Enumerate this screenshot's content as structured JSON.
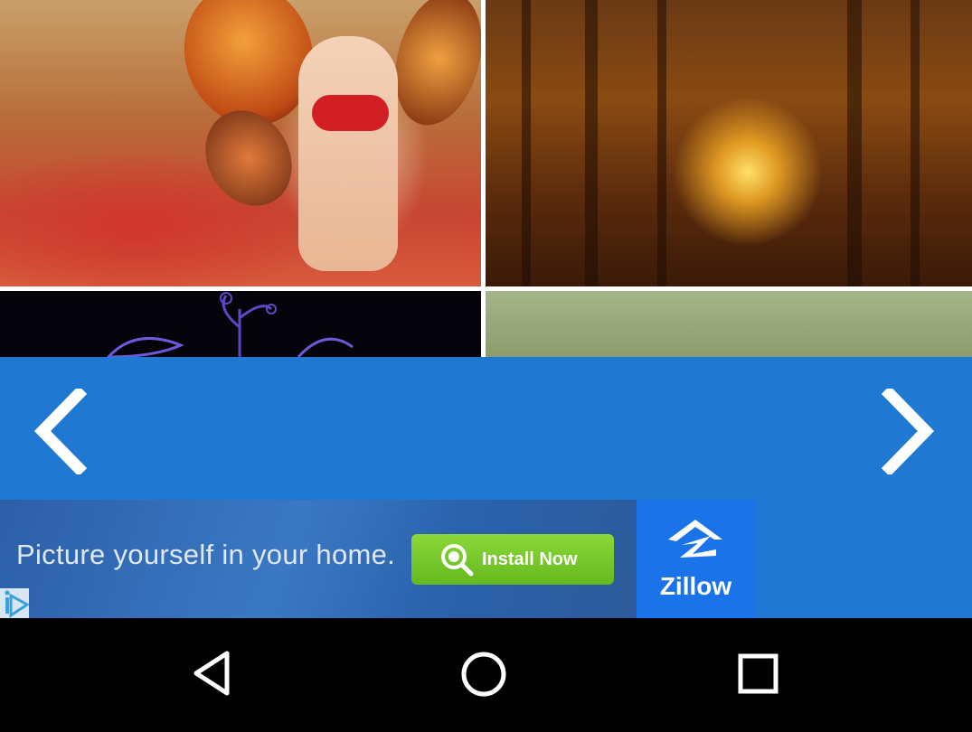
{
  "gallery": {
    "tiles": [
      "butterfly-fairy-wallpaper",
      "glowing-fairy-forest-wallpaper",
      "dark-flower-wallpaper",
      "green-texture-wallpaper"
    ]
  },
  "navigation": {
    "prev_icon": "chevron-left-icon",
    "next_icon": "chevron-right-icon",
    "bar_color": "#1f78d1"
  },
  "ad": {
    "headline": "Picture yourself in your home.",
    "cta_label": "Install Now",
    "brand": "Zillow",
    "cta_color": "#76c82a"
  },
  "system_nav": {
    "back_icon": "back-triangle-icon",
    "home_icon": "home-circle-icon",
    "recents_icon": "recents-square-icon"
  }
}
